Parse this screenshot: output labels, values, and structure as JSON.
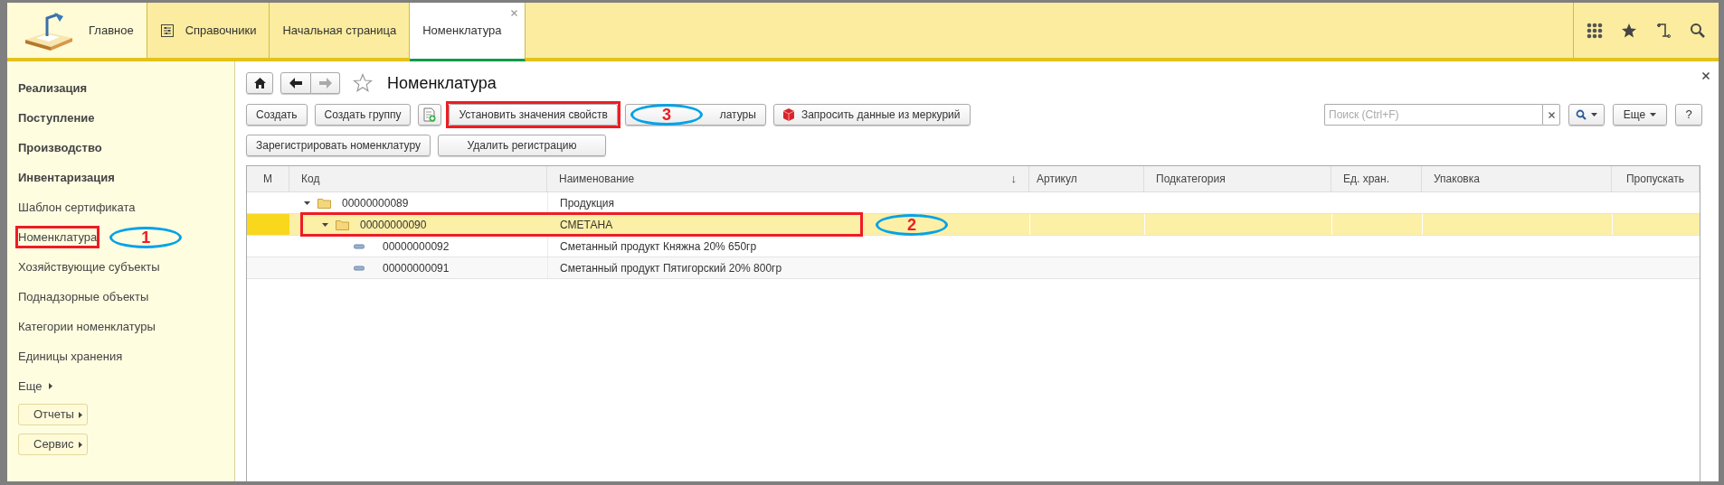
{
  "top_tabs": [
    {
      "label": "Главное",
      "kind": "home",
      "selected": false
    },
    {
      "label": "Справочники",
      "kind": "catalog",
      "selected": false
    },
    {
      "label": "Начальная страница",
      "kind": "page",
      "selected": false
    },
    {
      "label": "Номенклатура",
      "kind": "page",
      "selected": true,
      "closable": true
    }
  ],
  "sidebar": {
    "items": [
      {
        "label": "Реализация",
        "kind": "section"
      },
      {
        "label": "Поступление",
        "kind": "section"
      },
      {
        "label": "Производство",
        "kind": "section"
      },
      {
        "label": "Инвентаризация",
        "kind": "section"
      },
      {
        "label": "Шаблон сертификата",
        "kind": "link"
      },
      {
        "label": "Номенклатура",
        "kind": "link",
        "annotation": "1"
      },
      {
        "label": "Хозяйствующие субъекты",
        "kind": "link"
      },
      {
        "label": "Поднадзорные объекты",
        "kind": "link"
      },
      {
        "label": "Категории номенклатуры",
        "kind": "link"
      },
      {
        "label": "Единицы хранения",
        "kind": "link"
      },
      {
        "label": "Еще",
        "kind": "more"
      },
      {
        "label": "Отчеты",
        "kind": "button"
      },
      {
        "label": "Сервис",
        "kind": "button"
      }
    ]
  },
  "form": {
    "title": "Номенклатура",
    "toolbar_rows": [
      [
        {
          "label": "Создать",
          "kind": "button"
        },
        {
          "label": "Создать группу",
          "kind": "button"
        },
        {
          "kind": "add-icon"
        },
        {
          "label": "Установить значения свойств",
          "kind": "button",
          "annotation": "3"
        },
        {
          "label": "латуры",
          "kind": "button"
        },
        {
          "label": "Запросить данные из меркурий",
          "kind": "cube-button"
        }
      ],
      [
        {
          "label": "Зарегистрировать номенклатуру",
          "kind": "button"
        },
        {
          "label": "Удалить регистрацию",
          "kind": "button"
        }
      ]
    ],
    "search": {
      "placeholder": "Поиск (Ctrl+F)"
    },
    "more_button": "Еще",
    "help_button": "?",
    "table": {
      "columns": [
        {
          "label": "М"
        },
        {
          "label": "Код"
        },
        {
          "label": "Наименование",
          "sort": "↓"
        },
        {
          "label": "Артикул"
        },
        {
          "label": "Подкатегория"
        },
        {
          "label": "Ед. хран."
        },
        {
          "label": "Упаковка"
        },
        {
          "label": "Пропускать"
        }
      ],
      "rows": [
        {
          "code": "00000000089",
          "name": "Продукция",
          "kind": "group",
          "expanded": true,
          "selected": false,
          "children": [
            {
              "code": "00000000090",
              "name": "СМЕТАНА",
              "kind": "group",
              "expanded": true,
              "selected": true,
              "annotation": "2",
              "children": [
                {
                  "code": "00000000092",
                  "name": "Сметанный продукт Княжна 20% 650гр",
                  "kind": "item",
                  "selected": false
                },
                {
                  "code": "00000000091",
                  "name": "Сметанный продукт Пятигорский 20% 800гр",
                  "kind": "item",
                  "selected": false
                }
              ]
            }
          ]
        }
      ]
    }
  }
}
